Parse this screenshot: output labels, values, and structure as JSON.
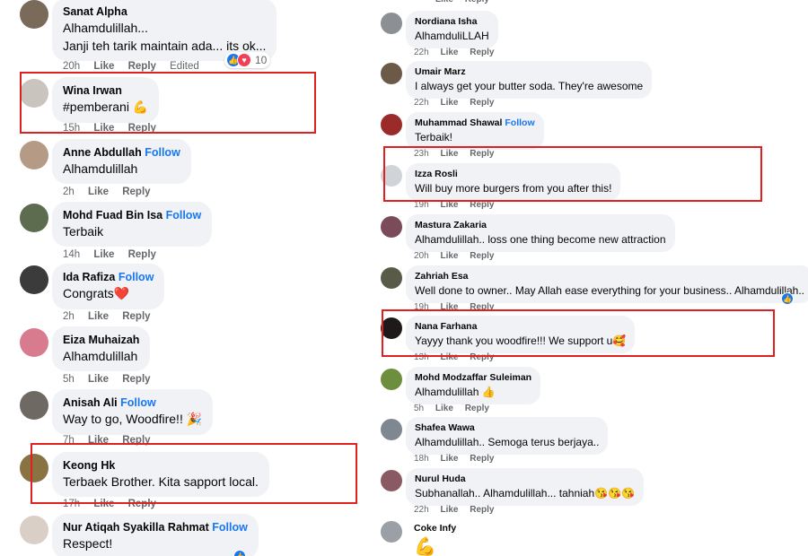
{
  "follow_label": "Follow",
  "like_label": "Like",
  "reply_label": "Reply",
  "edited_label": "Edited",
  "colors": {
    "link": "#1877f2",
    "bubble": "#f0f2f5",
    "meta": "#65676b",
    "highlight": "#e02020"
  },
  "left_comments": [
    {
      "name": "Sanat Alpha",
      "lines": [
        "Alhamdulillah...",
        "Janji teh tarik maintain ada... its ok..."
      ],
      "time": "20h",
      "edited": true,
      "reaction_count": "10",
      "avatar_color": "#7a6a5a"
    },
    {
      "name": "Wina Irwan",
      "lines": [
        "#pemberani 💪"
      ],
      "time": "15h",
      "avatar_color": "#c9c4bd"
    },
    {
      "name": "Anne Abdullah",
      "follow": true,
      "lines": [
        "Alhamdulillah"
      ],
      "time": "2h",
      "avatar_color": "#b59a86"
    },
    {
      "name": "Mohd Fuad Bin Isa",
      "follow": true,
      "lines": [
        "Terbaik"
      ],
      "time": "14h",
      "avatar_color": "#5d6b4f"
    },
    {
      "name": "Ida Rafiza",
      "follow": true,
      "lines": [
        "Congrats❤️"
      ],
      "time": "2h",
      "avatar_color": "#3b3b3b"
    },
    {
      "name": "Eiza Muhaizah",
      "lines": [
        "Alhamdulillah"
      ],
      "time": "5h",
      "avatar_color": "#d87b8f"
    },
    {
      "name": "Anisah Ali",
      "follow": true,
      "lines": [
        "Way to go, Woodfire!! 🎉"
      ],
      "time": "7h",
      "avatar_color": "#6e6a63"
    },
    {
      "name": "Keong Hk",
      "lines": [
        "Terbaek Brother. Kita sapport local."
      ],
      "time": "17h",
      "avatar_color": "#8a7343"
    },
    {
      "name": "Nur Atiqah Syakilla Rahmat",
      "follow": true,
      "lines": [
        "Respect!"
      ],
      "time": "",
      "avatar_color": "#d9cfc7"
    }
  ],
  "right_comments": [
    {
      "name": "Nordiana Isha",
      "lines": [
        "AlhamduliLLAH"
      ],
      "time": "22h",
      "avatar_color": "#8c8f93"
    },
    {
      "name": "Umair Marz",
      "lines": [
        "I always get your butter soda. They're awesome"
      ],
      "time": "22h",
      "avatar_color": "#6b5a48"
    },
    {
      "name": "Muhammad Shawal",
      "follow": true,
      "lines": [
        "Terbaik!"
      ],
      "time": "23h",
      "avatar_color": "#9b2b2b"
    },
    {
      "name": "Izza Rosli",
      "lines": [
        "Will buy more burgers from you after this!"
      ],
      "time": "19h",
      "avatar_color": "#d0d3d8"
    },
    {
      "name": "Mastura Zakaria",
      "lines": [
        "Alhamdulillah.. loss one thing become new attraction"
      ],
      "time": "20h",
      "avatar_color": "#7b4b5a"
    },
    {
      "name": "Zahriah Esa",
      "lines": [
        "Well done to owner.. May Allah ease everything for your business.. Alhamdulillah.."
      ],
      "time": "19h",
      "avatar_color": "#5a5a48"
    },
    {
      "name": "Nana Farhana",
      "lines": [
        "Yayyy thank you woodfire!!! We support u🥰"
      ],
      "time": "13h",
      "avatar_color": "#1e1a1a"
    },
    {
      "name": "Mohd Modzaffar Suleiman",
      "lines": [
        "Alhamdulillah 👍"
      ],
      "time": "5h",
      "avatar_color": "#6d8f3d"
    },
    {
      "name": "Shafea Wawa",
      "lines": [
        "Alhamdulillah.. Semoga terus berjaya.."
      ],
      "time": "18h",
      "avatar_color": "#7f8790"
    },
    {
      "name": "Nurul Huda",
      "lines": [
        "Subhanallah.. Alhamdulillah... tahniah😘😘😘"
      ],
      "time": "22h",
      "avatar_color": "#8a5a63"
    },
    {
      "name": "Coke Infy",
      "lines": [
        "💪"
      ],
      "time": "",
      "avatar_color": "#9aa0a6"
    }
  ]
}
